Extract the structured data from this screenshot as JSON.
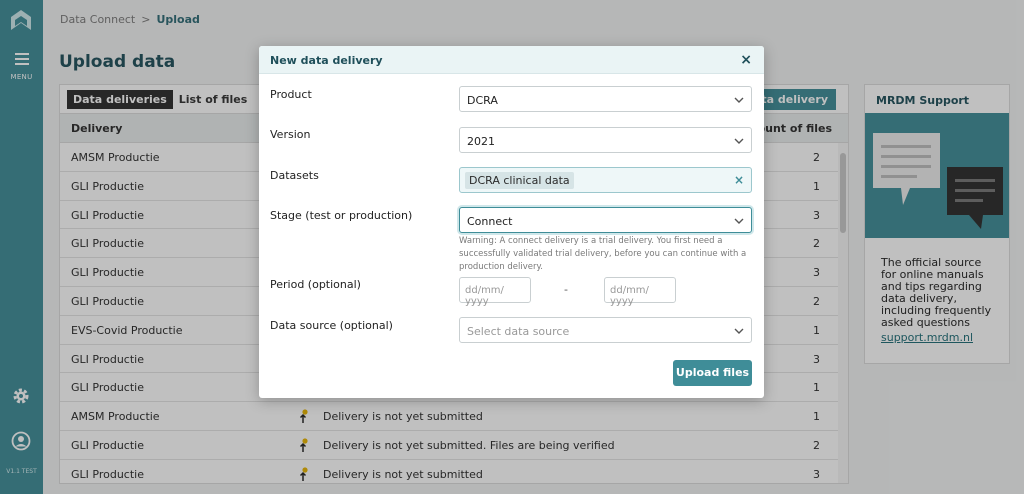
{
  "sidebar": {
    "menu_label": "MENU",
    "version_text": "V1.1 TEST"
  },
  "breadcrumb": {
    "parent": "Data Connect",
    "separator": ">",
    "current": "Upload"
  },
  "page": {
    "title": "Upload data"
  },
  "table": {
    "tabs": [
      {
        "label": "Data deliveries",
        "active": true
      },
      {
        "label": "List of files",
        "active": false
      }
    ],
    "new_button_label": "New data delivery",
    "columns": {
      "delivery": "Delivery",
      "amount": "Amount of files"
    },
    "rows": [
      {
        "delivery": "AMSM Productie",
        "status": "",
        "amount": "2"
      },
      {
        "delivery": "GLI Productie",
        "status": "",
        "amount": "1"
      },
      {
        "delivery": "GLI Productie",
        "status": "",
        "amount": "3"
      },
      {
        "delivery": "GLI Productie",
        "status": "",
        "amount": "2"
      },
      {
        "delivery": "GLI Productie",
        "status": "",
        "amount": "3"
      },
      {
        "delivery": "GLI Productie",
        "status": "",
        "amount": "2"
      },
      {
        "delivery": "EVS-Covid Productie",
        "status": "",
        "amount": "1"
      },
      {
        "delivery": "GLI Productie",
        "status": "",
        "amount": "3"
      },
      {
        "delivery": "GLI Productie",
        "status": "",
        "amount": "1"
      },
      {
        "delivery": "AMSM Productie",
        "status": "Delivery is not yet submitted",
        "amount": "1"
      },
      {
        "delivery": "GLI Productie",
        "status": "Delivery is not yet submitted. Files are being verified",
        "amount": "2"
      },
      {
        "delivery": "GLI Productie",
        "status": "Delivery is not yet submitted",
        "amount": "3"
      }
    ]
  },
  "support": {
    "title": "MRDM Support",
    "description": "The official source for online manuals and tips regarding data delivery, including frequently asked questions",
    "link": "support.mrdm.nl"
  },
  "modal": {
    "title": "New data delivery",
    "close": "×",
    "product_label": "Product",
    "product_value": "DCRA",
    "version_label": "Version",
    "version_value": "2021",
    "datasets_label": "Datasets",
    "datasets_tag": "DCRA clinical data",
    "datasets_clear": "×",
    "stage_label": "Stage (test or production)",
    "stage_value": "Connect",
    "stage_warning": "Warning: A connect delivery is a trial delivery. You first need a successfully validated trial delivery, before you can continue with a production delivery.",
    "period_label": "Period (optional)",
    "period_from_placeholder": "dd/mm/ yyyy",
    "period_separator": "-",
    "period_to_placeholder": "dd/mm/ yyyy",
    "source_label": "Data source (optional)",
    "source_placeholder": "Select data source",
    "upload_label": "Upload files"
  },
  "colors": {
    "accent": "#3f8d98",
    "heading": "#1f4f5a",
    "status_icon": "#e8b400"
  },
  "icons": {
    "logo": "mrdm-logo-icon",
    "menu": "hamburger-icon",
    "settings": "gear-icon",
    "account": "user-icon",
    "chevron": "chevron-down-icon",
    "status": "upload-arrow-icon"
  }
}
